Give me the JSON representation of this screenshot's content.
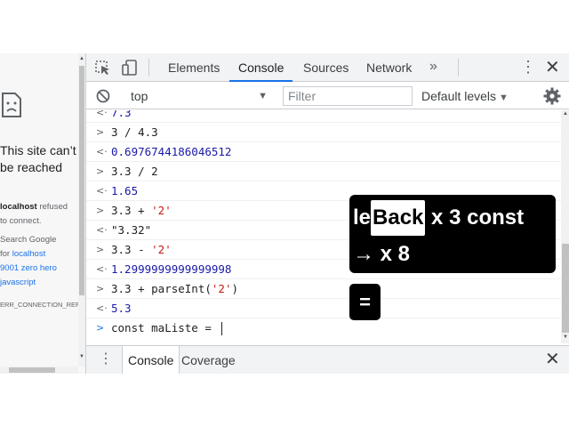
{
  "page": {
    "title": "This site can’t be reached",
    "host": "localhost",
    "refused_tail": " refused",
    "refused_line2": "to connect.",
    "search_prefix": "Search Google",
    "search_for": "for ",
    "search_link1": "localhost",
    "search_link2": "9001 zero hero",
    "search_link3": "javascript",
    "error_code": "ERR_CONNECTION_REF"
  },
  "devtools": {
    "tabs": [
      "Elements",
      "Console",
      "Sources",
      "Network"
    ],
    "active_tab": "Console",
    "more_tabs": "»",
    "menu": "⋮",
    "close": "✕"
  },
  "toolbar": {
    "context": "top",
    "filter_placeholder": "Filter",
    "levels": "Default levels"
  },
  "console": {
    "rows": [
      {
        "kind": "out",
        "text": "7.3"
      },
      {
        "kind": "in",
        "text": "3 / 4.3"
      },
      {
        "kind": "out",
        "text": "0.6976744186046512"
      },
      {
        "kind": "in",
        "text": "3.3 / 2"
      },
      {
        "kind": "out",
        "text": "1.65"
      },
      {
        "kind": "in",
        "pre": "3.3 + ",
        "str": "'2'"
      },
      {
        "kind": "str",
        "text": "\"3.32\""
      },
      {
        "kind": "in",
        "pre": "3.3 - ",
        "str": "'2'"
      },
      {
        "kind": "out",
        "text": "1.2999999999999998"
      },
      {
        "kind": "in",
        "pre": "3.3 + parseInt(",
        "str": "'2'",
        "post": ")"
      },
      {
        "kind": "out",
        "text": "5.3"
      }
    ],
    "prompt": "const maListe = "
  },
  "drawer": {
    "menu": "⋮",
    "tabs": [
      "Console",
      "Coverage"
    ],
    "active_tab": "Console",
    "close": "✕"
  },
  "captions": {
    "line1_a": "le",
    "line1_highlight": "Back",
    "line1_b": " x 3 const",
    "line2": "→ x 8",
    "box2": "="
  },
  "colors": {
    "accent": "#1a73e8",
    "string": "#c41a16",
    "number": "#1a1aa6",
    "caption_bg": "#000000"
  }
}
